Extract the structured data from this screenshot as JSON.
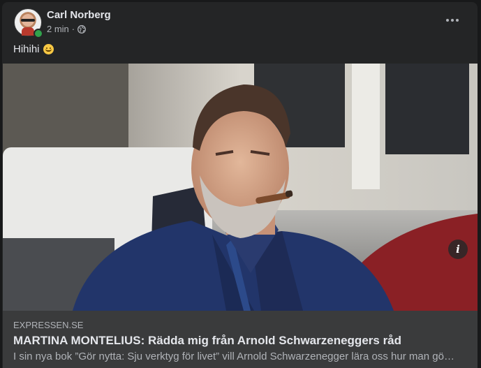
{
  "post": {
    "author": "Carl Norberg",
    "time": "2 min",
    "separator": "·",
    "privacy_icon": "globe-icon",
    "text": "Hihihi",
    "emoji": "slightly-smiling-face-icon",
    "more_icon": "more-horizontal-icon"
  },
  "link": {
    "domain": "EXPRESSEN.SE",
    "title": "MARTINA MONTELIUS: Rädda mig från Arnold Schwarzeneggers råd",
    "description": "I sin nya bok ”Gör nytta: Sju verktyg för livet” vill Arnold Schwarzenegger lära oss hur man gö…",
    "info_icon": "i"
  },
  "colors": {
    "card_bg": "#242526",
    "page_bg": "#18191a",
    "link_footer_bg": "#3a3b3c",
    "primary_text": "#e4e6eb",
    "secondary_text": "#b0b3b8",
    "online": "#31a24c"
  }
}
